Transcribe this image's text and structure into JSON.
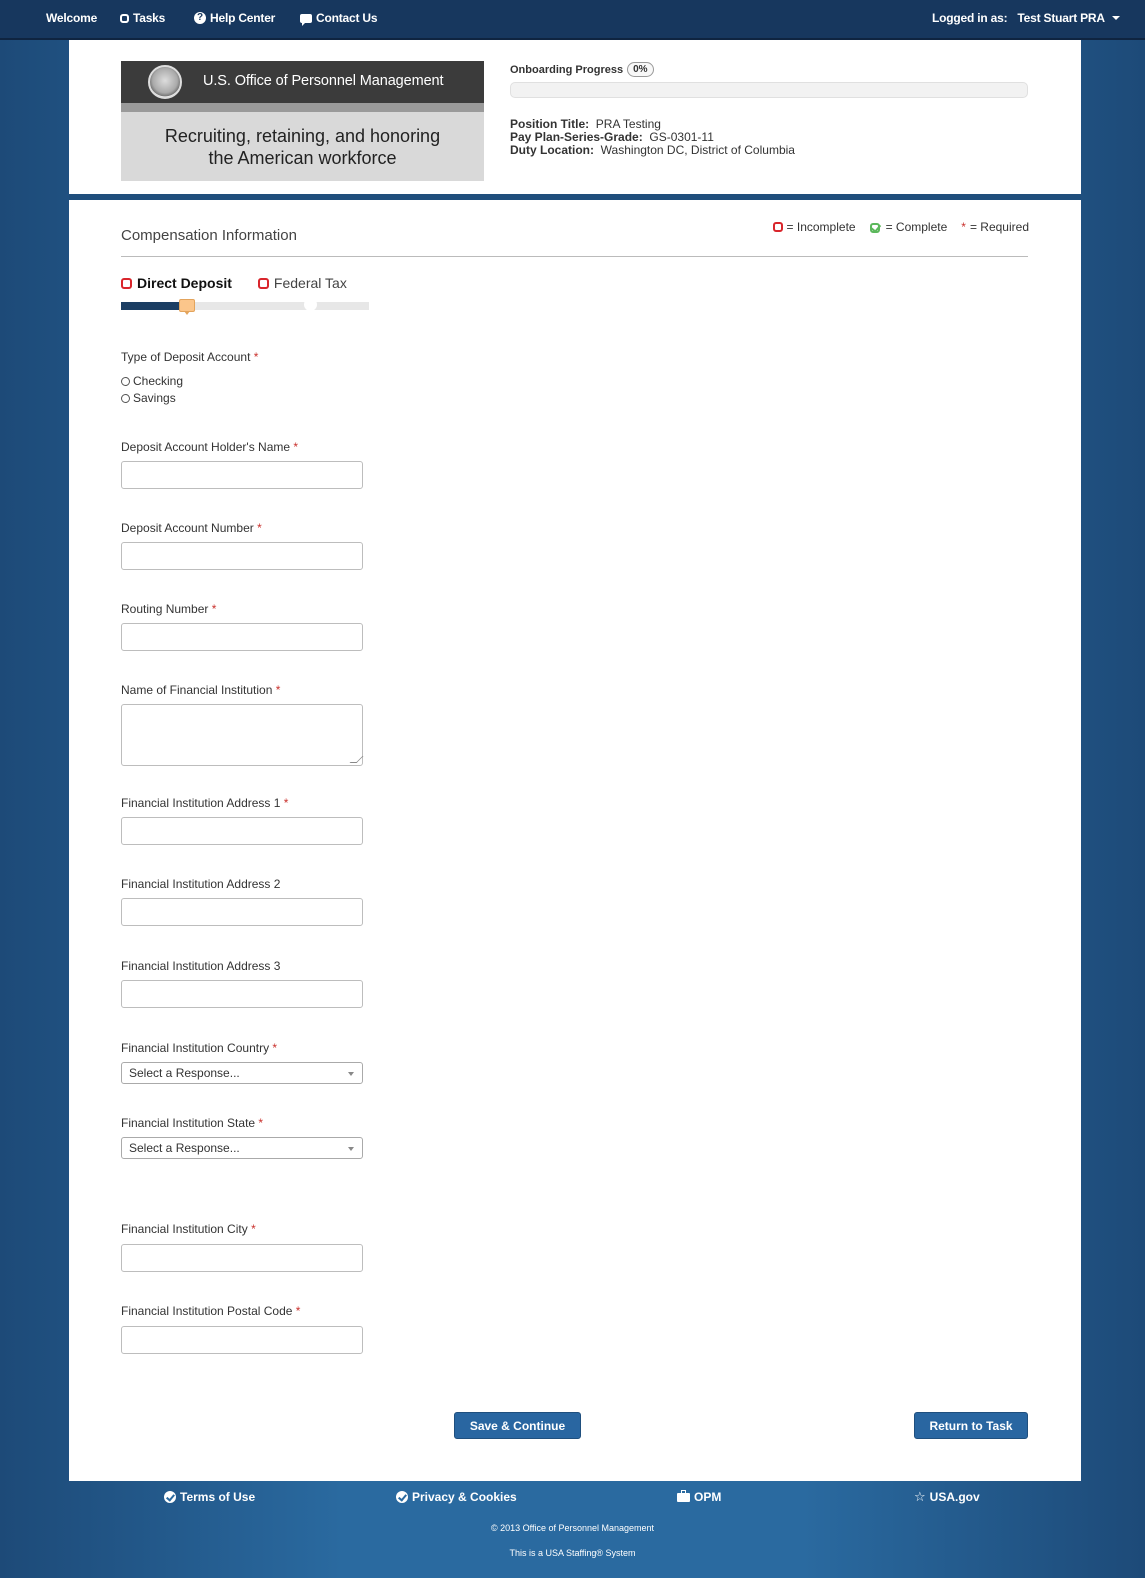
{
  "nav": {
    "welcome": "Welcome",
    "tasks": "Tasks",
    "help": "Help Center",
    "contact": "Contact Us",
    "logged_in_prefix": "Logged in as:",
    "user": "Test Stuart PRA"
  },
  "header": {
    "logo_org": "U.S. Office of Personnel Management",
    "logo_tagline_1": "Recruiting, retaining, and honoring",
    "logo_tagline_2": "the American workforce",
    "progress_label": "Onboarding Progress",
    "progress_value": "0%",
    "progress_fraction": 0,
    "position_title_label": "Position Title:",
    "position_title": "PRA Testing",
    "pay_plan_label": "Pay Plan-Series-Grade:",
    "pay_plan": "GS-0301-11",
    "duty_location_label": "Duty Location:",
    "duty_location": "Washington DC, District of Columbia"
  },
  "section": {
    "title": "Compensation Information",
    "legend_incomplete": "= Incomplete",
    "legend_complete": "= Complete",
    "legend_required": "= Required",
    "legend_star": "*"
  },
  "steps": [
    {
      "label": "Direct Deposit",
      "status": "incomplete",
      "active": true
    },
    {
      "label": "Federal Tax",
      "status": "incomplete",
      "active": false
    }
  ],
  "form": {
    "deposit_type_label": "Type of Deposit Account",
    "deposit_type_options": [
      "Checking",
      "Savings"
    ],
    "holder_name_label": "Deposit Account Holder's Name",
    "account_number_label": "Deposit Account Number",
    "routing_label": "Routing Number",
    "institution_name_label": "Name of Financial Institution",
    "address1_label": "Financial Institution Address 1",
    "address2_label": "Financial Institution Address 2",
    "address3_label": "Financial Institution Address 3",
    "country_label": "Financial Institution Country",
    "country_value": "Select a Response...",
    "state_label": "Financial Institution State",
    "state_value": "Select a Response...",
    "city_label": "Financial Institution City",
    "postal_label": "Financial Institution Postal Code",
    "required_mark": "*"
  },
  "buttons": {
    "save": "Save & Continue",
    "return": "Return to Task"
  },
  "footer": {
    "terms": "Terms of Use",
    "privacy": "Privacy & Cookies",
    "opm": "OPM",
    "usagov": "USA.gov",
    "copyright": "© 2013 Office of Personnel Management",
    "system": "This is a USA Staffing® System"
  },
  "colors": {
    "nav_bg": "#17375e",
    "accent": "#2966a1",
    "incomplete": "#d9262c",
    "complete": "#5cb85c",
    "required": "#c9302c"
  }
}
